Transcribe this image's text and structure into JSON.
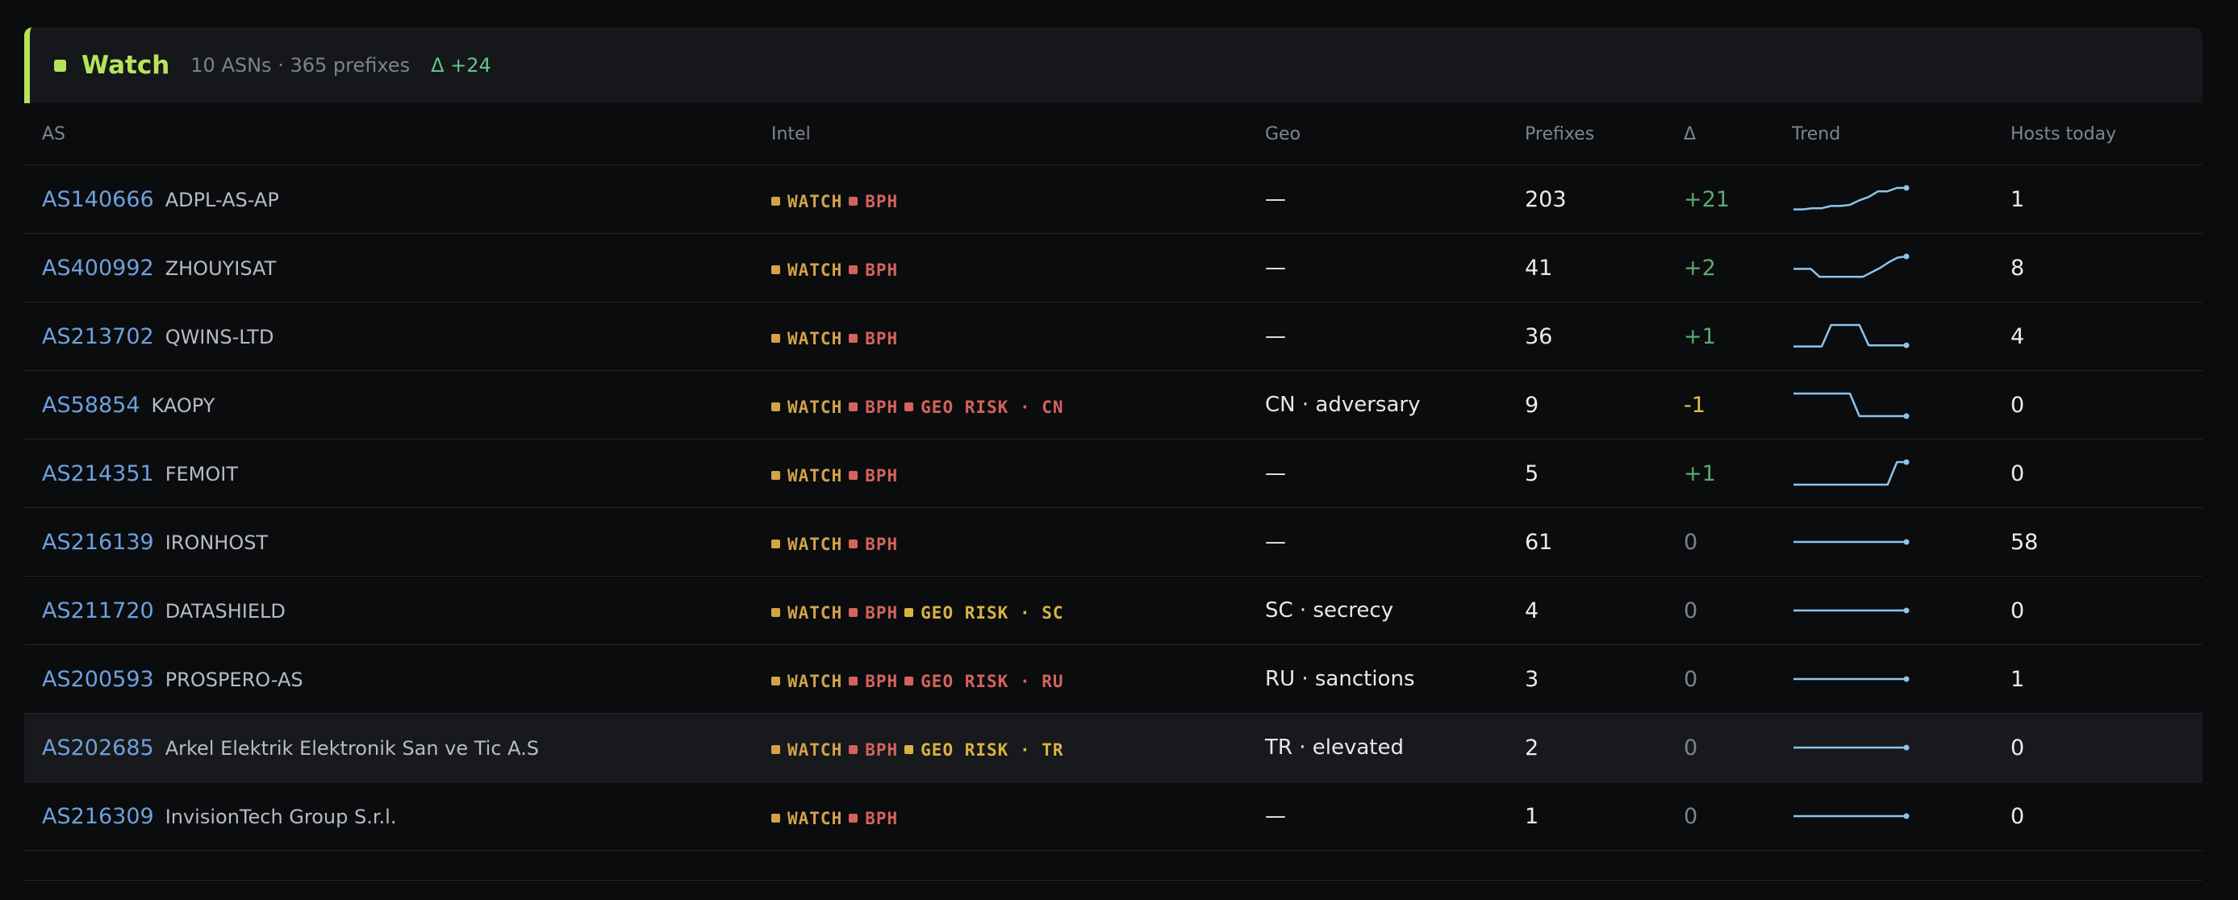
{
  "section": {
    "title": "Watch",
    "subtitle": "10 ASNs · 365 prefixes",
    "delta": "Δ +24",
    "accent": "#b5e35b"
  },
  "columns": {
    "as": "AS",
    "intel": "Intel",
    "geo": "Geo",
    "prefixes": "Prefixes",
    "delta": "Δ",
    "trend": "Trend",
    "hosts": "Hosts today"
  },
  "rows": [
    {
      "asn": "AS140666",
      "name": "ADPL-AS-AP",
      "tags": [
        {
          "label": "WATCH",
          "kind": "watch"
        },
        {
          "label": "BPH",
          "kind": "bph"
        }
      ],
      "geo": "—",
      "prefixes": "203",
      "delta": "+21",
      "delta_kind": "pos",
      "trend": [
        0.05,
        0.05,
        0.1,
        0.1,
        0.2,
        0.2,
        0.25,
        0.45,
        0.6,
        0.85,
        0.85,
        1.0,
        1.0
      ],
      "hosts": "1"
    },
    {
      "asn": "AS400992",
      "name": "ZHOUYISAT",
      "tags": [
        {
          "label": "WATCH",
          "kind": "watch"
        },
        {
          "label": "BPH",
          "kind": "bph"
        }
      ],
      "geo": "—",
      "prefixes": "41",
      "delta": "+2",
      "delta_kind": "pos",
      "trend": [
        0.45,
        0.45,
        0.45,
        0.1,
        0.1,
        0.1,
        0.1,
        0.1,
        0.1,
        0.3,
        0.5,
        0.75,
        0.95,
        1.0
      ],
      "hosts": "8"
    },
    {
      "asn": "AS213702",
      "name": "QWINS-LTD",
      "tags": [
        {
          "label": "WATCH",
          "kind": "watch"
        },
        {
          "label": "BPH",
          "kind": "bph"
        }
      ],
      "geo": "—",
      "prefixes": "36",
      "delta": "+1",
      "delta_kind": "pos",
      "trend": [
        0.05,
        0.05,
        0.05,
        0.05,
        1.0,
        1.0,
        1.0,
        1.0,
        0.1,
        0.1,
        0.1,
        0.1,
        0.1
      ],
      "hosts": "4"
    },
    {
      "asn": "AS58854",
      "name": "KAOPY",
      "tags": [
        {
          "label": "WATCH",
          "kind": "watch"
        },
        {
          "label": "BPH",
          "kind": "bph"
        },
        {
          "label": "GEO RISK · CN",
          "kind": "geo-red"
        }
      ],
      "geo": "CN · adversary",
      "prefixes": "9",
      "delta": "-1",
      "delta_kind": "neg",
      "trend": [
        1.0,
        1.0,
        1.0,
        1.0,
        1.0,
        1.0,
        1.0,
        0.0,
        0.0,
        0.0,
        0.0,
        0.0,
        0.0
      ],
      "hosts": "0"
    },
    {
      "asn": "AS214351",
      "name": "FEMOIT",
      "tags": [
        {
          "label": "WATCH",
          "kind": "watch"
        },
        {
          "label": "BPH",
          "kind": "bph"
        }
      ],
      "geo": "—",
      "prefixes": "5",
      "delta": "+1",
      "delta_kind": "pos",
      "trend": [
        0.0,
        0.0,
        0.0,
        0.0,
        0.0,
        0.0,
        0.0,
        0.0,
        0.0,
        0.0,
        0.0,
        1.0,
        1.0
      ],
      "hosts": "0"
    },
    {
      "asn": "AS216139",
      "name": "IRONHOST",
      "tags": [
        {
          "label": "WATCH",
          "kind": "watch"
        },
        {
          "label": "BPH",
          "kind": "bph"
        }
      ],
      "geo": "—",
      "prefixes": "61",
      "delta": "0",
      "delta_kind": "zero",
      "trend": [
        0.5,
        0.5,
        0.5,
        0.5,
        0.5,
        0.5,
        0.5,
        0.5,
        0.5,
        0.5,
        0.5,
        0.5,
        0.5
      ],
      "hosts": "58"
    },
    {
      "asn": "AS211720",
      "name": "DATASHIELD",
      "tags": [
        {
          "label": "WATCH",
          "kind": "watch"
        },
        {
          "label": "BPH",
          "kind": "bph"
        },
        {
          "label": "GEO RISK · SC",
          "kind": "geo-amber"
        }
      ],
      "geo": "SC · secrecy",
      "prefixes": "4",
      "delta": "0",
      "delta_kind": "zero",
      "trend": [
        0.5,
        0.5,
        0.5,
        0.5,
        0.5,
        0.5,
        0.5,
        0.5,
        0.5,
        0.5,
        0.5,
        0.5,
        0.5
      ],
      "hosts": "0"
    },
    {
      "asn": "AS200593",
      "name": "PROSPERO-AS",
      "tags": [
        {
          "label": "WATCH",
          "kind": "watch"
        },
        {
          "label": "BPH",
          "kind": "bph"
        },
        {
          "label": "GEO RISK · RU",
          "kind": "geo-red"
        }
      ],
      "geo": "RU · sanctions",
      "prefixes": "3",
      "delta": "0",
      "delta_kind": "zero",
      "trend": [
        0.5,
        0.5,
        0.5,
        0.5,
        0.5,
        0.5,
        0.5,
        0.5,
        0.5,
        0.5,
        0.5,
        0.5,
        0.5
      ],
      "hosts": "1"
    },
    {
      "asn": "AS202685",
      "name": "Arkel Elektrik Elektronik San ve Tic A.S",
      "tags": [
        {
          "label": "WATCH",
          "kind": "watch"
        },
        {
          "label": "BPH",
          "kind": "bph"
        },
        {
          "label": "GEO RISK · TR",
          "kind": "geo-amber"
        }
      ],
      "geo": "TR · elevated",
      "prefixes": "2",
      "delta": "0",
      "delta_kind": "zero",
      "trend": [
        0.5,
        0.5,
        0.5,
        0.5,
        0.5,
        0.5,
        0.5,
        0.5,
        0.5,
        0.5,
        0.5,
        0.5,
        0.5
      ],
      "hosts": "0",
      "highlighted": true
    },
    {
      "asn": "AS216309",
      "name": "InvisionTech Group S.r.l.",
      "tags": [
        {
          "label": "WATCH",
          "kind": "watch"
        },
        {
          "label": "BPH",
          "kind": "bph"
        }
      ],
      "geo": "—",
      "prefixes": "1",
      "delta": "0",
      "delta_kind": "zero",
      "trend": [
        0.5,
        0.5,
        0.5,
        0.5,
        0.5,
        0.5,
        0.5,
        0.5,
        0.5,
        0.5,
        0.5,
        0.5,
        0.5
      ],
      "hosts": "0"
    }
  ],
  "colors": {
    "asn_link": "#6ea0dd",
    "watch_tag": "#d4a24a",
    "bph_tag": "#d4635c",
    "geo_risk_red": "#d4635c",
    "geo_risk_amber": "#d9b342",
    "delta_positive": "#5aaa72",
    "delta_negative": "#e3c34c",
    "sparkline": "#8ec5ec"
  }
}
